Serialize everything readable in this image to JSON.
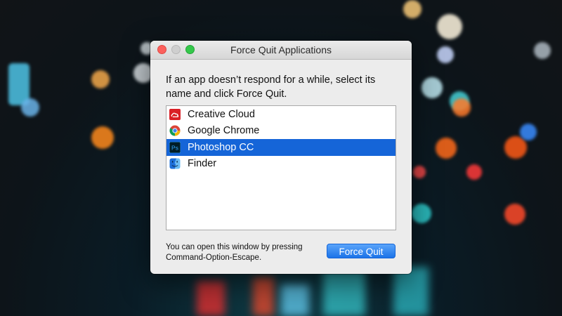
{
  "window": {
    "title": "Force Quit Applications",
    "instructions": "If an app doesn’t respond for a while, select its name and click Force Quit.",
    "footer_text": "You can open this window by pressing Command-Option-Escape.",
    "force_quit_label": "Force Quit"
  },
  "apps": [
    {
      "name": "Creative Cloud",
      "icon": "creative-cloud-icon",
      "selected": false
    },
    {
      "name": "Google Chrome",
      "icon": "chrome-icon",
      "selected": false
    },
    {
      "name": "Photoshop CC",
      "icon": "photoshop-icon",
      "icon_text": "Ps",
      "selected": true
    },
    {
      "name": "Finder",
      "icon": "finder-icon",
      "selected": false
    }
  ],
  "colors": {
    "selection": "#1565d8",
    "close": "#fc605c",
    "zoom": "#34c84a",
    "button": "#1b73e8"
  }
}
